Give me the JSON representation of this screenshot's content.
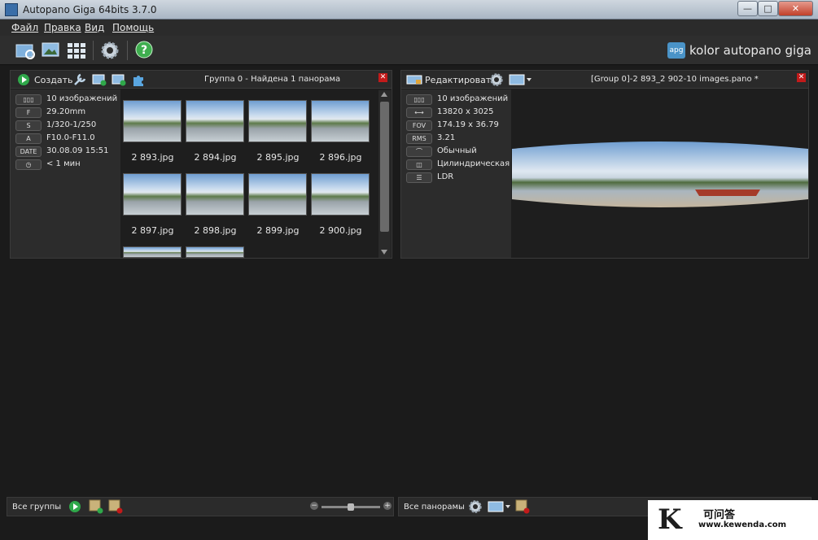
{
  "window": {
    "title": "Autopano Giga 64bits 3.7.0",
    "min_glyph": "—",
    "max_glyph": "□",
    "close_glyph": "✕"
  },
  "menu": [
    "Файл",
    "Правка",
    "Вид",
    "Помощь"
  ],
  "toolbar": {
    "icons": [
      "folder-open-icon",
      "image-add-icon",
      "grid-icon",
      "gear-icon",
      "help-icon"
    ],
    "brand_logo": "apg",
    "brand_text": "kolor autopano giga"
  },
  "left_panel": {
    "create_label": "Создать",
    "header_title": "Группа 0 - Найдена 1 панорама",
    "info": [
      {
        "badge": "▯▯▯",
        "text": "10 изображений"
      },
      {
        "badge": "F",
        "text": "29.20mm"
      },
      {
        "badge": "S",
        "text": "1/320-1/250"
      },
      {
        "badge": "A",
        "text": "F10.0-F11.0"
      },
      {
        "badge": "DATE",
        "text": "30.08.09 15:51"
      },
      {
        "badge": "◷",
        "text": "< 1 мин"
      }
    ],
    "thumbnails": [
      "2 893.jpg",
      "2 894.jpg",
      "2 895.jpg",
      "2 896.jpg",
      "2 897.jpg",
      "2 898.jpg",
      "2 899.jpg",
      "2 900.jpg",
      "",
      ""
    ]
  },
  "right_panel": {
    "edit_label": "Редактировать",
    "header_title": "[Group 0]-2 893_2 902-10 images.pano *",
    "info": [
      {
        "badge": "▯▯▯",
        "text": "10 изображений"
      },
      {
        "badge": "⟷",
        "text": "13820 x 3025"
      },
      {
        "badge": "FOV",
        "text": "174.19 x 36.79"
      },
      {
        "badge": "RMS",
        "text": "3.21"
      },
      {
        "badge": "⌒",
        "text": "Обычный"
      },
      {
        "badge": "◫",
        "text": "Цилиндрическая"
      },
      {
        "badge": "☰",
        "text": "LDR"
      }
    ]
  },
  "status": {
    "left_label": "Все группы",
    "right_label": "Все панорамы",
    "zoom_minus": "−",
    "zoom_plus": "+"
  },
  "watermark": {
    "letter": "K",
    "cn": "可问答",
    "url": "www.kewenda.com"
  },
  "colors": {
    "accent_blue": "#4a93c7",
    "close_red": "#c21a1a",
    "play_green": "#2fa84a"
  }
}
